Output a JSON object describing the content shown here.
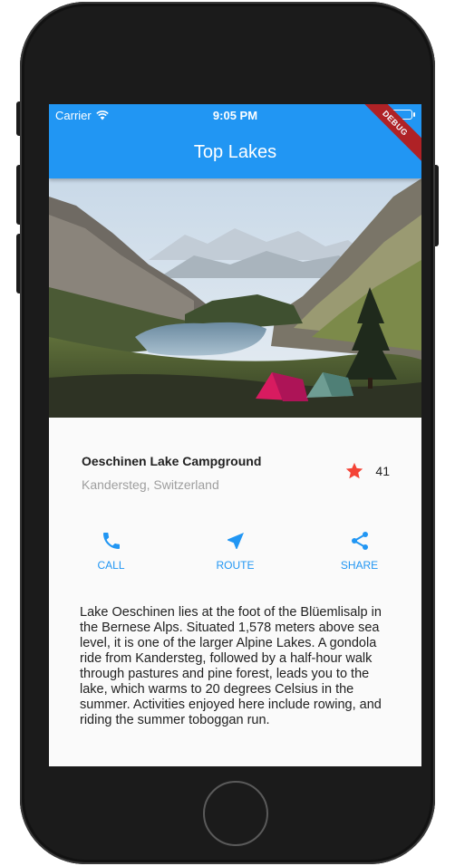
{
  "status_bar": {
    "carrier": "Carrier",
    "time": "9:05 PM"
  },
  "app_bar": {
    "title": "Top Lakes"
  },
  "debug_banner": "DEBUG",
  "place": {
    "name": "Oeschinen Lake Campground",
    "location": "Kandersteg, Switzerland",
    "rating_count": "41"
  },
  "actions": [
    {
      "label": "CALL",
      "icon": "phone-icon"
    },
    {
      "label": "ROUTE",
      "icon": "navigation-arrow-icon"
    },
    {
      "label": "SHARE",
      "icon": "share-icon"
    }
  ],
  "description": "Lake Oeschinen lies at the foot of the Blüemlisalp in the Bernese Alps. Situated 1,578 meters above sea level, it is one of the larger Alpine Lakes. A gondola ride from Kandersteg, followed by a half-hour walk through pastures and pine forest, leads you to the lake, which warms to 20 degrees Celsius in the summer. Activities enjoyed here include rowing, and riding the summer toboggan run.",
  "colors": {
    "primary": "#2196f3",
    "star": "#f44336",
    "debug": "#b71c1c"
  }
}
